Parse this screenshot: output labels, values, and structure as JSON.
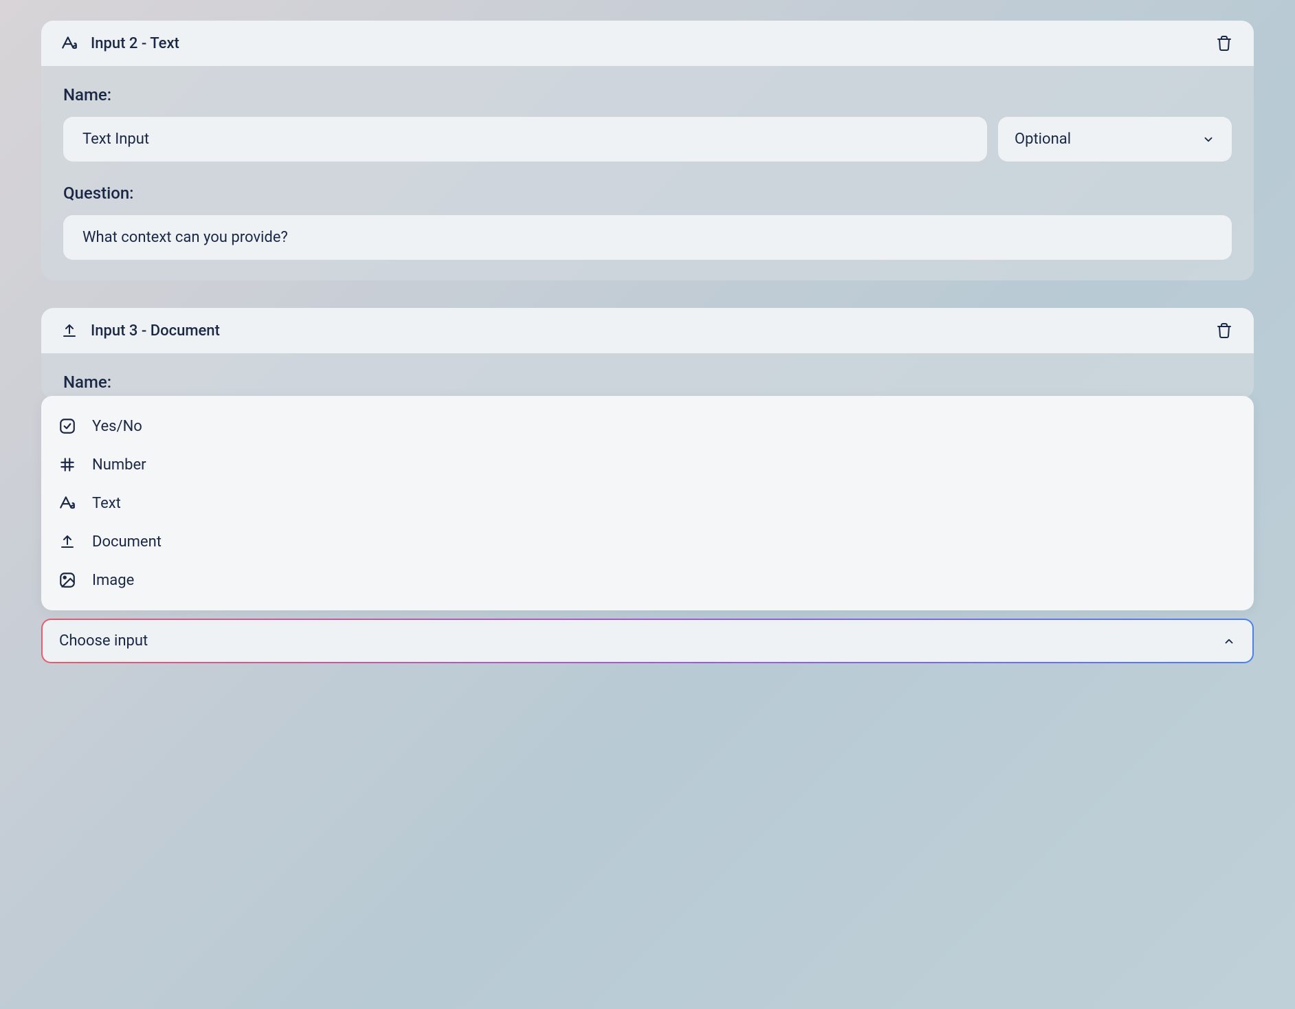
{
  "input2": {
    "title": "Input 2 - Text",
    "name_label": "Name:",
    "name_value": "Text Input",
    "selector_value": "Optional",
    "question_label": "Question:",
    "question_value": "What context can you provide?"
  },
  "input3": {
    "title": "Input 3 - Document",
    "name_label": "Name:"
  },
  "dropdown": {
    "items": [
      {
        "label": "Yes/No"
      },
      {
        "label": "Number"
      },
      {
        "label": "Text"
      },
      {
        "label": "Document"
      },
      {
        "label": "Image"
      }
    ]
  },
  "choose_input": {
    "label": "Choose input"
  }
}
